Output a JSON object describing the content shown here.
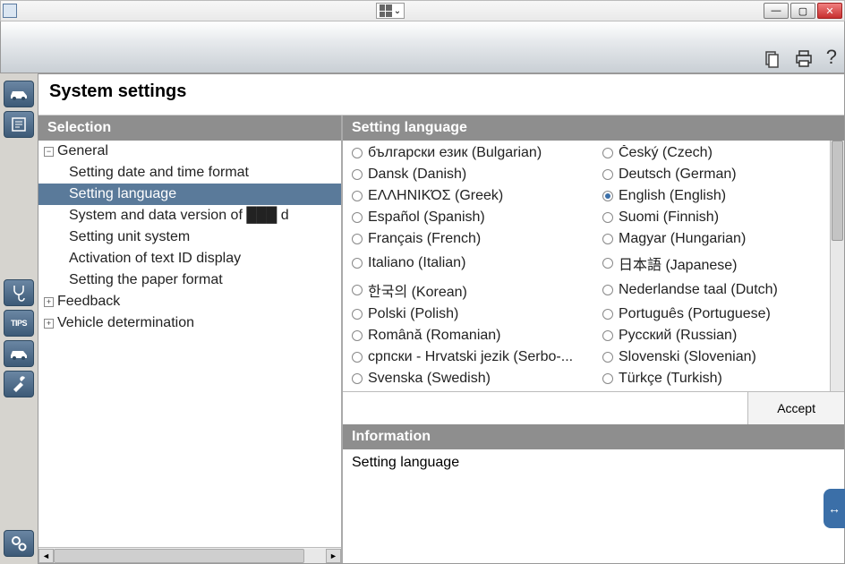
{
  "window_controls": {
    "minimize": "—",
    "maximize": "▢",
    "close": "✕"
  },
  "header_icons": {
    "copy": "copy-icon",
    "print": "print-icon",
    "help": "?"
  },
  "page_title": "System settings",
  "selection": {
    "header": "Selection",
    "nodes": [
      {
        "label": "General",
        "expanded": true,
        "children": [
          {
            "label": "Setting date and time format"
          },
          {
            "label": "Setting language",
            "selected": true
          },
          {
            "label": "System and data version of ███ d"
          },
          {
            "label": "Setting unit system"
          },
          {
            "label": "Activation of text ID display"
          },
          {
            "label": "Setting the paper format"
          }
        ]
      },
      {
        "label": "Feedback",
        "expanded": false
      },
      {
        "label": "Vehicle determination",
        "expanded": false
      }
    ]
  },
  "language_panel": {
    "header": "Setting language",
    "selected": "English (English)",
    "options": [
      [
        "български език (Bulgarian)",
        "Český (Czech)"
      ],
      [
        "Dansk (Danish)",
        "Deutsch (German)"
      ],
      [
        "ΕΛΛΗΝΙΚΌΣ (Greek)",
        "English (English)"
      ],
      [
        "Español (Spanish)",
        "Suomi (Finnish)"
      ],
      [
        "Français (French)",
        "Magyar (Hungarian)"
      ],
      [
        "Italiano (Italian)",
        "日本語 (Japanese)"
      ],
      [
        "한국의 (Korean)",
        "Nederlandse taal (Dutch)"
      ],
      [
        "Polski (Polish)",
        "Português (Portuguese)"
      ],
      [
        "Română (Romanian)",
        "Русский (Russian)"
      ],
      [
        "српски - Hrvatski jezik (Serbo-...",
        "Slovenski (Slovenian)"
      ],
      [
        "Svenska (Swedish)",
        "Türkçe (Turkish)"
      ]
    ],
    "accept_label": "Accept"
  },
  "information": {
    "header": "Information",
    "body": "Setting language"
  },
  "rail": [
    "vehicle",
    "document",
    "stethoscope",
    "tips",
    "vehicle2",
    "wrench",
    "gears"
  ]
}
